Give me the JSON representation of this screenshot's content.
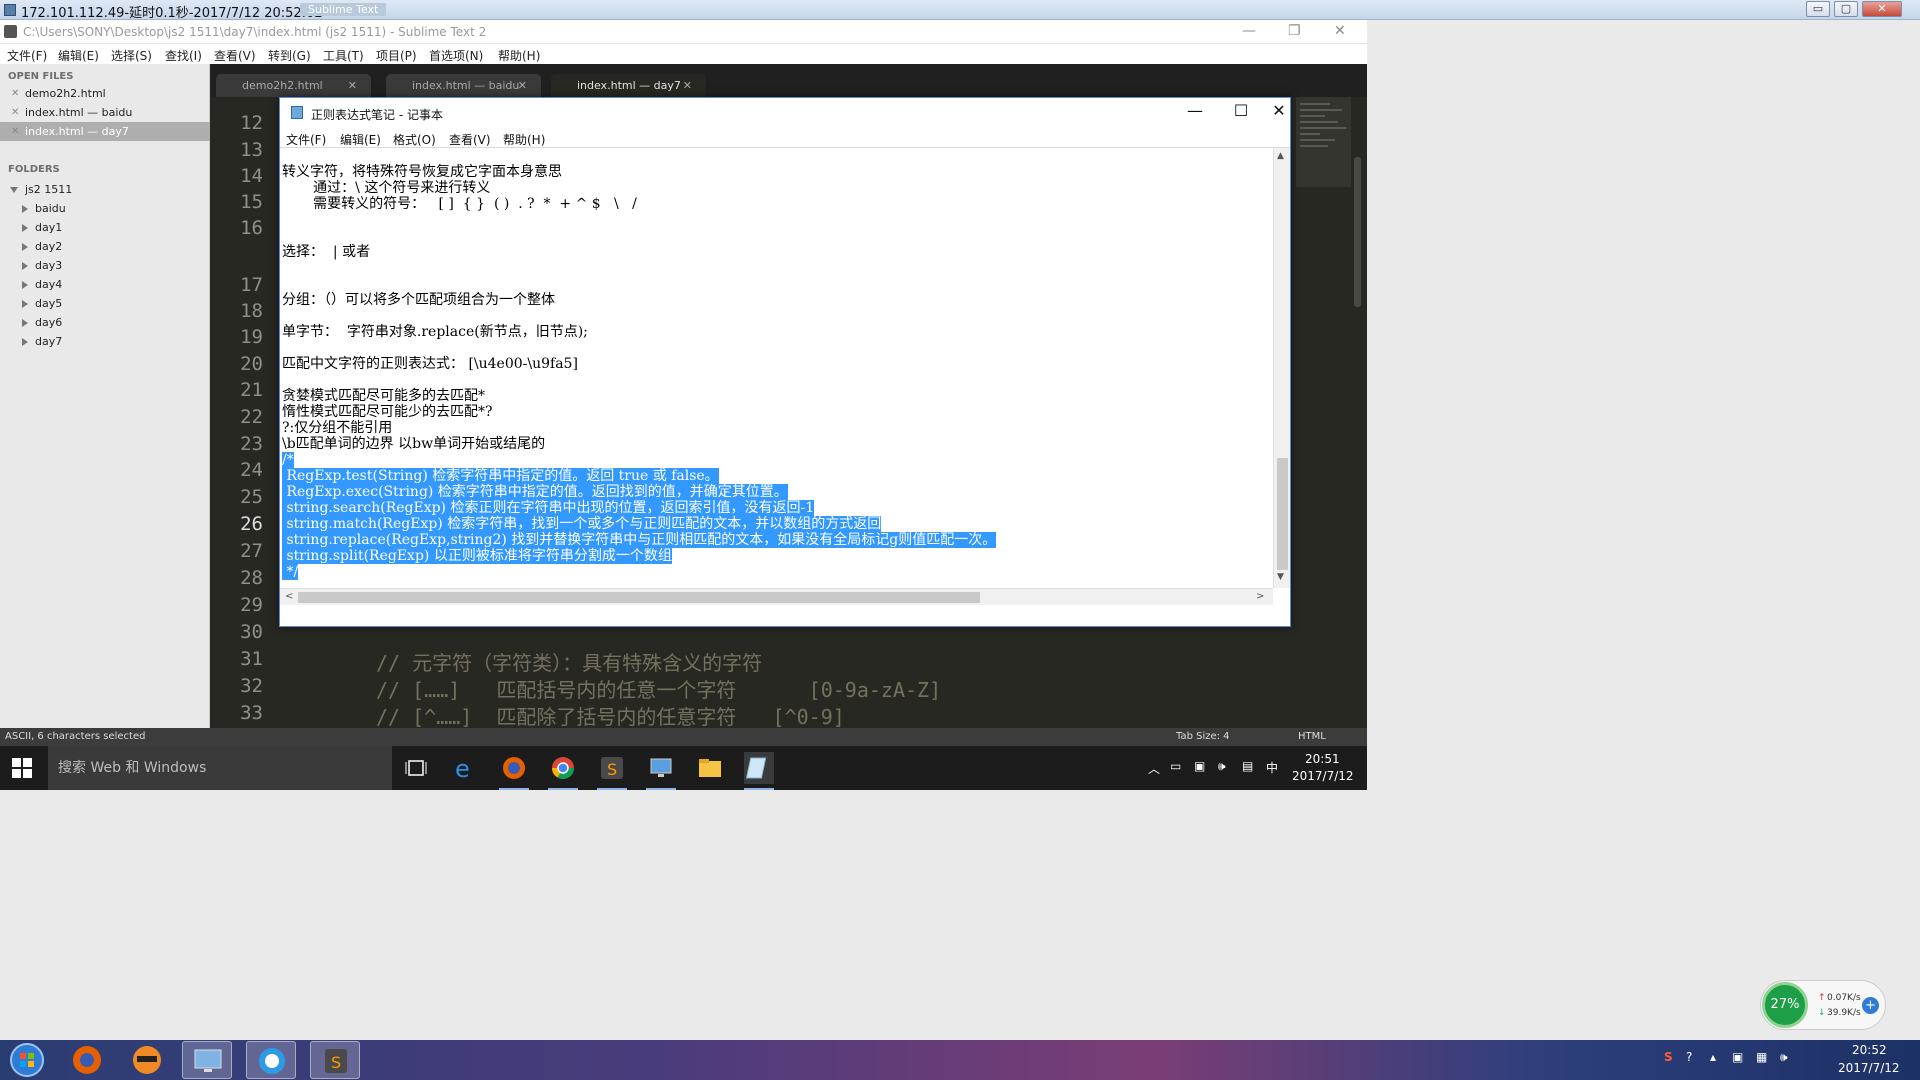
{
  "outer": {
    "title": "172.101.112.49-延时0.1秒-2017/7/12 20:52:02",
    "overlay_label": "Sublime Text",
    "controls": {
      "minimize": "▭",
      "maximize": "▢",
      "close": "✕"
    }
  },
  "sublime": {
    "title": "C:\\Users\\SONY\\Desktop\\js2 1511\\day7\\index.html (js2 1511) - Sublime Text 2",
    "window_controls": {
      "minimize": "—",
      "restore": "❐",
      "close": "✕"
    },
    "menu": [
      "文件(F)",
      "编辑(E)",
      "选择(S)",
      "查找(I)",
      "查看(V)",
      "转到(G)",
      "工具(T)",
      "项目(P)",
      "首选项(N)",
      "帮助(H)"
    ],
    "sidebar": {
      "open_files_header": "OPEN FILES",
      "open_files": [
        "demo2h2.html",
        "index.html — baidu",
        "index.html — day7"
      ],
      "folders_header": "FOLDERS",
      "root_folder": "js2 1511",
      "folders": [
        "baidu",
        "day1",
        "day2",
        "day3",
        "day4",
        "day5",
        "day6",
        "day7"
      ]
    },
    "tabs": [
      "demo2h2.html",
      "index.html — baidu",
      "index.html — day7"
    ],
    "line_numbers": [
      "12",
      "13",
      "14",
      "15",
      "16",
      "17",
      "18",
      "19",
      "20",
      "21",
      "22",
      "23",
      "24",
      "25",
      "26",
      "27",
      "28",
      "29",
      "30",
      "31",
      "32",
      "33"
    ],
    "code_lines": [
      "// 元字符（字符类）：具有特殊含义的字符",
      "// [……]   匹配括号内的任意一个字符      [0-9a-zA-Z]",
      "// [^……]  匹配除了括号内的任意字符   [^0-9]"
    ],
    "status": {
      "left": "ASCII, 6 characters selected",
      "tab_size": "Tab Size: 4",
      "syntax": "HTML"
    }
  },
  "notepad": {
    "title": "正则表达式笔记 - 记事本",
    "controls": {
      "minimize": "—",
      "maximize": "☐",
      "close": "✕"
    },
    "menu": [
      "文件(F)",
      "编辑(E)",
      "格式(O)",
      "查看(V)",
      "帮助(H)"
    ],
    "lines": [
      "转义字符，将特殊符号恢复成它字面本身意思",
      "       通过：\\ 这个符号来进行转义",
      "       需要转义的符号：   [ ]  { }  ( )  . ?  *  + ^ $   \\   /",
      "选择：  | 或者",
      "分组：（）可以将多个匹配项组合为一个整体",
      "单字节：  字符串对象.replace(新节点，旧节点);",
      "匹配中文字符的正则表达式： [\\u4e00-\\u9fa5]",
      "贪婪模式匹配尽可能多的去匹配*",
      "惰性模式匹配尽可能少的去匹配*?",
      "?:仅分组不能引用",
      "\\b匹配单词的边界 以bw单词开始或结尾的"
    ],
    "selected_lines": [
      "/*",
      " RegExp.test(String) 检索字符串中指定的值。返回 true 或 false。",
      " RegExp.exec(String) 检索字符串中指定的值。返回找到的值，并确定其位置。",
      " string.search(RegExp) 检索正则在字符串中出现的位置，返回索引值，没有返回-1",
      " string.match(RegExp) 检索字符串，找到一个或多个与正则匹配的文本，并以数组的方式返回",
      " string.replace(RegExp,string2) 找到并替换字符串中与正则相匹配的文本，如果没有全局标记g则值匹配一次。",
      " string.split(RegExp) 以正则被标准将字符串分割成一个数组",
      " */"
    ],
    "scroll": {
      "left": "<",
      "right": ">",
      "up": "▲",
      "down": "▼"
    }
  },
  "remote_taskbar": {
    "search_placeholder": "搜索 Web 和 Windows",
    "ime": "中",
    "time": "20:51",
    "date": "2017/7/12"
  },
  "local": {
    "net": {
      "percent": "27%",
      "up": "0.07K/s",
      "down": "39.9K/s",
      "plus": "+"
    },
    "time": "20:52",
    "date": "2017/7/12"
  }
}
